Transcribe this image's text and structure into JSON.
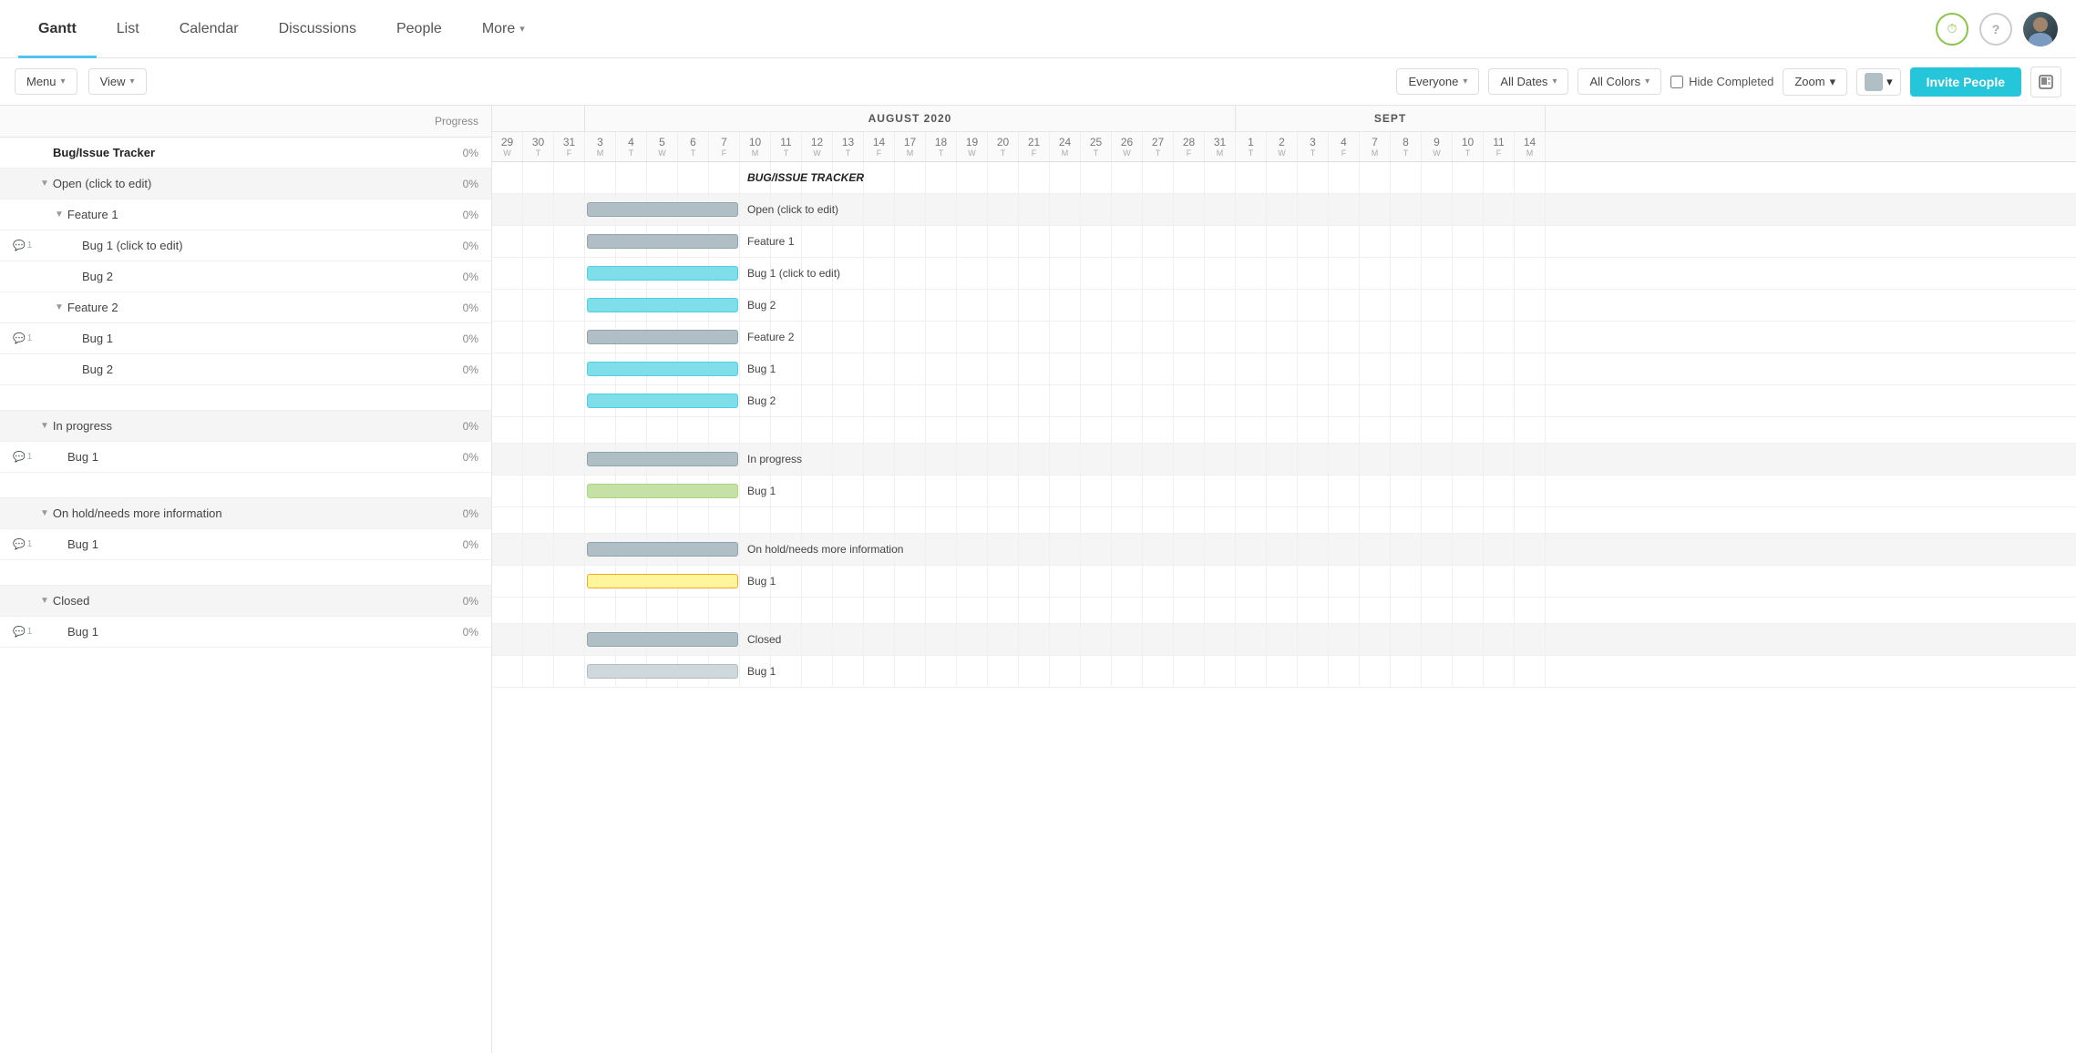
{
  "nav": {
    "tabs": [
      {
        "id": "gantt",
        "label": "Gantt",
        "active": true
      },
      {
        "id": "list",
        "label": "List",
        "active": false
      },
      {
        "id": "calendar",
        "label": "Calendar",
        "active": false
      },
      {
        "id": "discussions",
        "label": "Discussions",
        "active": false
      },
      {
        "id": "people",
        "label": "People",
        "active": false
      },
      {
        "id": "more",
        "label": "More",
        "hasChevron": true,
        "active": false
      }
    ],
    "clockIcon": "⏱",
    "helpIcon": "?",
    "inviteBtn": "Invite People"
  },
  "toolbar": {
    "menuBtn": "Menu",
    "viewBtn": "View",
    "everyoneBtn": "Everyone",
    "allDatesBtn": "All Dates",
    "allColorsBtn": "All Colors",
    "hideCompletedLabel": "Hide Completed",
    "zoomBtn": "Zoom",
    "inviteBtn": "Invite People"
  },
  "leftPanel": {
    "header": {
      "title": "",
      "progressLabel": "Progress"
    },
    "rows": [
      {
        "id": "main",
        "indent": 0,
        "label": "Bug/Issue Tracker",
        "progress": "0%",
        "isMainItem": true,
        "hasComment": false,
        "hasToggle": false
      },
      {
        "id": "open",
        "indent": 0,
        "label": "Open (click to edit)",
        "progress": "0%",
        "isSection": true,
        "hasComment": false,
        "hasToggle": true,
        "toggleOpen": true
      },
      {
        "id": "feat1",
        "indent": 1,
        "label": "Feature 1",
        "progress": "0%",
        "isSection": false,
        "hasComment": false,
        "hasToggle": true,
        "toggleOpen": true
      },
      {
        "id": "bug1a",
        "indent": 2,
        "label": "Bug 1 (click to edit)",
        "progress": "0%",
        "isSection": false,
        "hasComment": true,
        "commentCount": "1",
        "hasToggle": false
      },
      {
        "id": "bug2a",
        "indent": 2,
        "label": "Bug 2",
        "progress": "0%",
        "isSection": false,
        "hasComment": false,
        "hasToggle": false
      },
      {
        "id": "feat2",
        "indent": 1,
        "label": "Feature 2",
        "progress": "0%",
        "isSection": false,
        "hasComment": false,
        "hasToggle": true,
        "toggleOpen": true
      },
      {
        "id": "bug1b",
        "indent": 2,
        "label": "Bug 1",
        "progress": "0%",
        "isSection": false,
        "hasComment": true,
        "commentCount": "1",
        "hasToggle": false
      },
      {
        "id": "bug2b",
        "indent": 2,
        "label": "Bug 2",
        "progress": "0%",
        "isSection": false,
        "hasComment": false,
        "hasToggle": false
      },
      {
        "id": "empty1",
        "indent": 0,
        "label": "",
        "progress": "",
        "isEmpty": true
      },
      {
        "id": "inprogress",
        "indent": 0,
        "label": "In progress",
        "progress": "0%",
        "isSection": true,
        "hasComment": false,
        "hasToggle": true,
        "toggleOpen": true
      },
      {
        "id": "bug1c",
        "indent": 1,
        "label": "Bug 1",
        "progress": "0%",
        "isSection": false,
        "hasComment": true,
        "commentCount": "1",
        "hasToggle": false
      },
      {
        "id": "empty2",
        "indent": 0,
        "label": "",
        "progress": "",
        "isEmpty": true
      },
      {
        "id": "onhold",
        "indent": 0,
        "label": "On hold/needs more information",
        "progress": "0%",
        "isSection": true,
        "hasComment": false,
        "hasToggle": true,
        "toggleOpen": true
      },
      {
        "id": "bug1d",
        "indent": 1,
        "label": "Bug 1",
        "progress": "0%",
        "isSection": false,
        "hasComment": true,
        "commentCount": "1",
        "hasToggle": false
      },
      {
        "id": "empty3",
        "indent": 0,
        "label": "",
        "progress": "",
        "isEmpty": true
      },
      {
        "id": "closed",
        "indent": 0,
        "label": "Closed",
        "progress": "0%",
        "isSection": true,
        "hasComment": false,
        "hasToggle": true,
        "toggleOpen": true
      },
      {
        "id": "bug1e",
        "indent": 1,
        "label": "Bug 1",
        "progress": "0%",
        "isSection": false,
        "hasComment": true,
        "commentCount": "1",
        "hasToggle": false
      }
    ]
  },
  "gantt": {
    "months": [
      {
        "label": "",
        "cols": 3
      },
      {
        "label": "AUGUST 2020",
        "cols": 23
      },
      {
        "label": "SEPT",
        "cols": 10
      }
    ],
    "days": [
      {
        "num": "29",
        "letter": "W",
        "weekend": false
      },
      {
        "num": "30",
        "letter": "T",
        "weekend": false
      },
      {
        "num": "31",
        "letter": "F",
        "weekend": false
      },
      {
        "num": "3",
        "letter": "M",
        "weekend": false
      },
      {
        "num": "4",
        "letter": "T",
        "weekend": false
      },
      {
        "num": "5",
        "letter": "W",
        "weekend": false
      },
      {
        "num": "6",
        "letter": "T",
        "weekend": false
      },
      {
        "num": "7",
        "letter": "F",
        "weekend": false
      },
      {
        "num": "10",
        "letter": "M",
        "weekend": false
      },
      {
        "num": "11",
        "letter": "T",
        "weekend": false
      },
      {
        "num": "12",
        "letter": "W",
        "weekend": false
      },
      {
        "num": "13",
        "letter": "T",
        "weekend": false
      },
      {
        "num": "14",
        "letter": "F",
        "weekend": false
      },
      {
        "num": "17",
        "letter": "M",
        "weekend": false
      },
      {
        "num": "18",
        "letter": "T",
        "weekend": false
      },
      {
        "num": "19",
        "letter": "W",
        "weekend": false
      },
      {
        "num": "20",
        "letter": "T",
        "weekend": false
      },
      {
        "num": "21",
        "letter": "F",
        "weekend": false
      },
      {
        "num": "24",
        "letter": "M",
        "weekend": false
      },
      {
        "num": "25",
        "letter": "T",
        "weekend": false
      },
      {
        "num": "26",
        "letter": "W",
        "weekend": false
      },
      {
        "num": "27",
        "letter": "T",
        "weekend": false
      },
      {
        "num": "28",
        "letter": "F",
        "weekend": false
      },
      {
        "num": "31",
        "letter": "M",
        "weekend": false
      },
      {
        "num": "1",
        "letter": "T",
        "weekend": false
      },
      {
        "num": "2",
        "letter": "W",
        "weekend": false
      },
      {
        "num": "3",
        "letter": "T",
        "weekend": false
      },
      {
        "num": "4",
        "letter": "F",
        "weekend": false
      },
      {
        "num": "7",
        "letter": "M",
        "weekend": false
      },
      {
        "num": "8",
        "letter": "T",
        "weekend": false
      },
      {
        "num": "9",
        "letter": "W",
        "weekend": false
      },
      {
        "num": "10",
        "letter": "T",
        "weekend": false
      },
      {
        "num": "11",
        "letter": "F",
        "weekend": false
      },
      {
        "num": "14",
        "letter": "M",
        "weekend": false
      }
    ],
    "rows": [
      {
        "id": "main",
        "barStart": 3,
        "barEnd": 8,
        "barColor": "",
        "label": "BUG/ISSUE TRACKER",
        "labelBold": true,
        "isSection": false
      },
      {
        "id": "open",
        "barStart": 3,
        "barEnd": 8,
        "barColor": "gray",
        "label": "Open (click to edit)",
        "labelBold": false,
        "isSection": true
      },
      {
        "id": "feat1",
        "barStart": 3,
        "barEnd": 8,
        "barColor": "gray",
        "label": "Feature 1",
        "labelBold": false,
        "isSection": false
      },
      {
        "id": "bug1a",
        "barStart": 3,
        "barEnd": 8,
        "barColor": "cyan",
        "label": "Bug 1 (click to edit)",
        "labelBold": false,
        "isSection": false
      },
      {
        "id": "bug2a",
        "barStart": 3,
        "barEnd": 8,
        "barColor": "cyan",
        "label": "Bug 2",
        "labelBold": false,
        "isSection": false
      },
      {
        "id": "feat2",
        "barStart": 3,
        "barEnd": 8,
        "barColor": "gray",
        "label": "Feature 2",
        "labelBold": false,
        "isSection": false
      },
      {
        "id": "bug1b",
        "barStart": 3,
        "barEnd": 8,
        "barColor": "cyan",
        "label": "Bug 1",
        "labelBold": false,
        "isSection": false
      },
      {
        "id": "bug2b",
        "barStart": 3,
        "barEnd": 8,
        "barColor": "cyan",
        "label": "Bug 2",
        "labelBold": false,
        "isSection": false
      },
      {
        "id": "empty1",
        "barStart": -1,
        "barEnd": -1,
        "barColor": "",
        "label": "",
        "isEmpty": true
      },
      {
        "id": "inprogress",
        "barStart": 3,
        "barEnd": 8,
        "barColor": "gray",
        "label": "In progress",
        "labelBold": false,
        "isSection": true
      },
      {
        "id": "bug1c",
        "barStart": 3,
        "barEnd": 8,
        "barColor": "green",
        "label": "Bug 1",
        "labelBold": false,
        "isSection": false
      },
      {
        "id": "empty2",
        "barStart": -1,
        "barEnd": -1,
        "barColor": "",
        "label": "",
        "isEmpty": true
      },
      {
        "id": "onhold",
        "barStart": 3,
        "barEnd": 8,
        "barColor": "gray",
        "label": "On hold/needs more information",
        "labelBold": false,
        "isSection": true
      },
      {
        "id": "bug1d",
        "barStart": 3,
        "barEnd": 8,
        "barColor": "yellow",
        "label": "Bug 1",
        "labelBold": false,
        "isSection": false
      },
      {
        "id": "empty3",
        "barStart": -1,
        "barEnd": -1,
        "barColor": "",
        "label": "",
        "isEmpty": true
      },
      {
        "id": "closed",
        "barStart": 3,
        "barEnd": 8,
        "barColor": "gray",
        "label": "Closed",
        "labelBold": false,
        "isSection": true
      },
      {
        "id": "bug1e",
        "barStart": 3,
        "barEnd": 8,
        "barColor": "lightgray",
        "label": "Bug 1",
        "labelBold": false,
        "isSection": false
      }
    ]
  }
}
